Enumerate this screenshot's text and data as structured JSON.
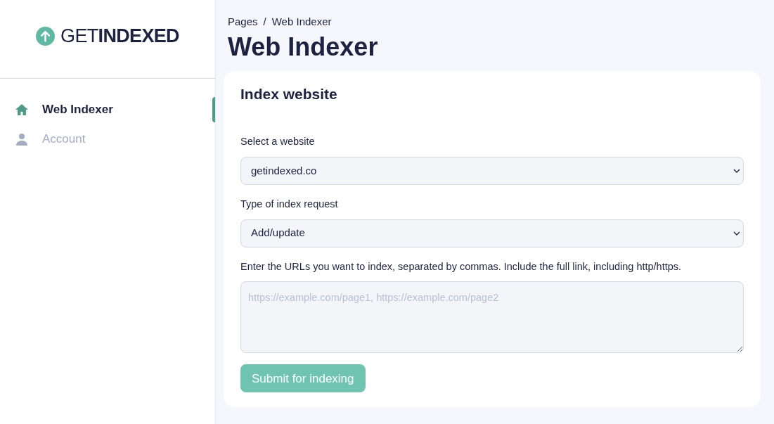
{
  "sidebar": {
    "logo": "GET**INDEXED**",
    "items": [
      {
        "label": "Web Indexer",
        "kind": "home",
        "selected": true
      },
      {
        "label": "Account",
        "kind": "person",
        "selected": false
      }
    ]
  },
  "breadcrumb": [
    "Pages",
    "Web Indexer"
  ],
  "breadcrumb_separator": "/",
  "title": "Web Indexer",
  "card": {
    "title": "Index website",
    "fields": [
      {
        "kind": "select",
        "label": "Select a website",
        "value": "getindexed.co"
      },
      {
        "kind": "select",
        "label": "Type of index request",
        "value": "Add/update"
      },
      {
        "kind": "textarea",
        "label": "Enter the URLs you want to index, separated by commas. Include the full link, including http/https.",
        "placeholder": "https://example.com/page1, https://example.com/page2"
      }
    ],
    "button": {
      "label": "Submit for indexing",
      "disabled": true
    }
  }
}
